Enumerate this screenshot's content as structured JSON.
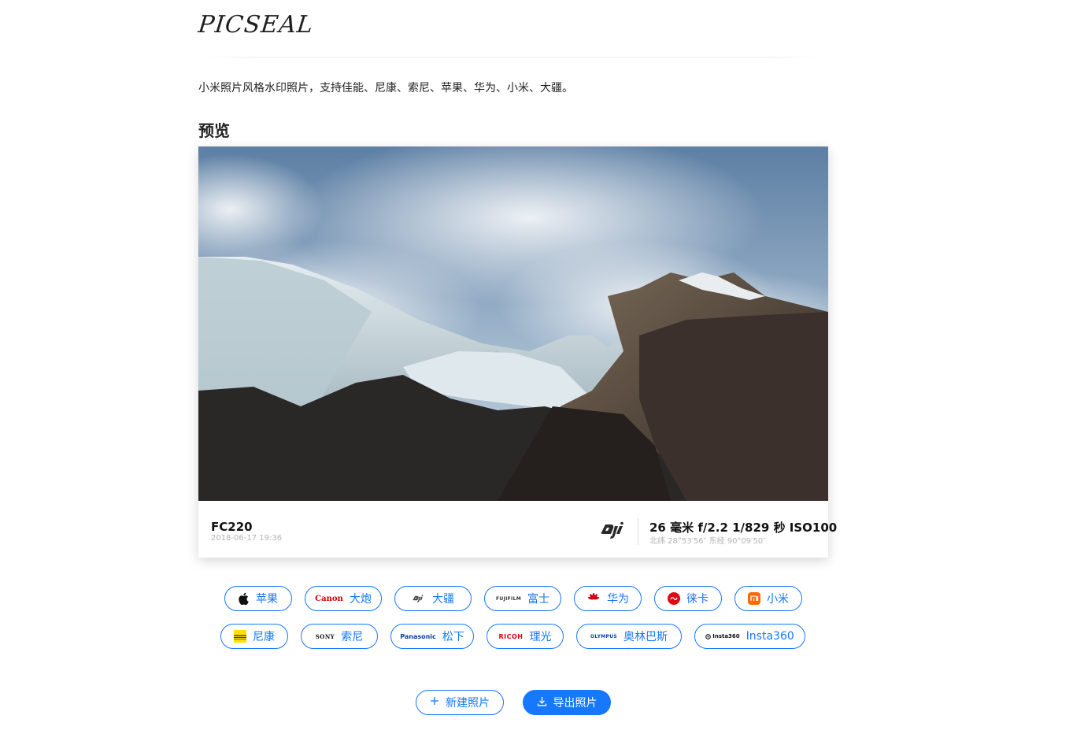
{
  "header": {
    "logo": "PICSEAL"
  },
  "intro": {
    "description": "小米照片风格水印照片，支持佳能、尼康、索尼、苹果、华为、小米、大疆。"
  },
  "preview": {
    "title": "预览",
    "watermark": {
      "model": "FC220",
      "datetime": "2018-06-17 19:36",
      "brand_logo": "dji-logo",
      "params": "26 毫米 f/2.2 1/829 秒 ISO100",
      "location": "北纬 28°53′56″ 东经 90°09′50″"
    }
  },
  "brands": {
    "row1": [
      {
        "label": "苹果",
        "logo": "apple-logo"
      },
      {
        "label": "大炮",
        "logo": "canon-logo",
        "logo_text": "Canon"
      },
      {
        "label": "大疆",
        "logo": "dji-logo"
      },
      {
        "label": "富士",
        "logo": "fujifilm-logo",
        "logo_text": "FUJIFILM"
      },
      {
        "label": "华为",
        "logo": "huawei-logo"
      },
      {
        "label": "徕卡",
        "logo": "leica-logo"
      },
      {
        "label": "小米",
        "logo": "xiaomi-logo"
      }
    ],
    "row2": [
      {
        "label": "尼康",
        "logo": "nikon-logo"
      },
      {
        "label": "索尼",
        "logo": "sony-logo",
        "logo_text": "SONY"
      },
      {
        "label": "松下",
        "logo": "panasonic-logo",
        "logo_text": "Panasonic"
      },
      {
        "label": "理光",
        "logo": "ricoh-logo",
        "logo_text": "RICOH"
      },
      {
        "label": "奥林巴斯",
        "logo": "olympus-logo",
        "logo_text": "OLYMPUS"
      },
      {
        "label": "Insta360",
        "logo": "insta360-logo",
        "logo_text": "Insta360"
      }
    ]
  },
  "actions": {
    "new_label": "新建照片",
    "export_label": "导出照片"
  },
  "colors": {
    "accent": "#1677ff",
    "text": "#222222",
    "muted": "#b3b3b3"
  }
}
